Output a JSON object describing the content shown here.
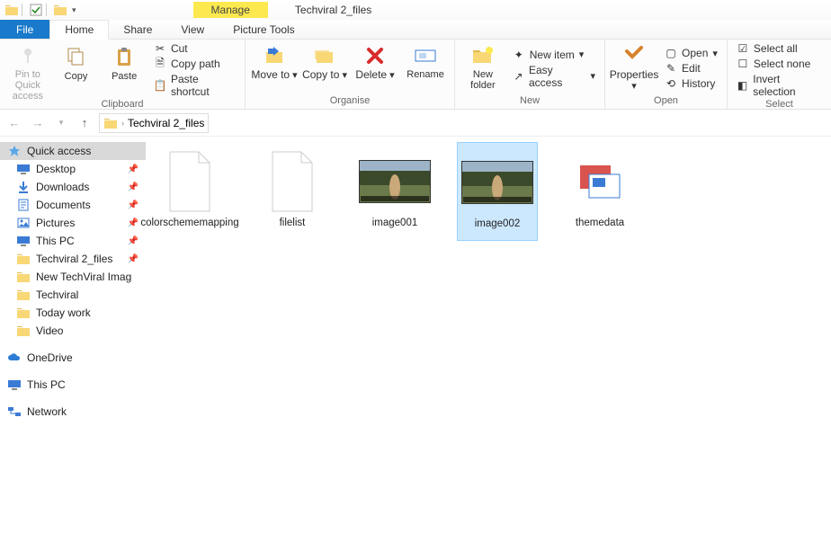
{
  "colors": {
    "accent": "#1979ca",
    "selected_bg": "#cce8ff",
    "context_tab": "#fce94f"
  },
  "titlebar": {
    "manage": "Manage",
    "title": "Techviral 2_files"
  },
  "tabs": {
    "file": "File",
    "home": "Home",
    "share": "Share",
    "view": "View",
    "context": "Picture Tools"
  },
  "ribbon": {
    "clipboard": {
      "label": "Clipboard",
      "pin": "Pin to Quick access",
      "copy": "Copy",
      "paste": "Paste",
      "cut": "Cut",
      "copy_path": "Copy path",
      "paste_shortcut": "Paste shortcut"
    },
    "organise": {
      "label": "Organise",
      "move_to": "Move to",
      "copy_to": "Copy to",
      "delete": "Delete",
      "rename": "Rename"
    },
    "new": {
      "label": "New",
      "new_folder": "New folder",
      "new_item": "New item",
      "easy_access": "Easy access"
    },
    "open": {
      "label": "Open",
      "properties": "Properties",
      "open": "Open",
      "edit": "Edit",
      "history": "History"
    },
    "select": {
      "label": "Select",
      "select_all": "Select all",
      "select_none": "Select none",
      "invert": "Invert selection"
    }
  },
  "breadcrumb": {
    "current": "Techviral 2_files"
  },
  "navpane": {
    "quick_access": "Quick access",
    "items": [
      {
        "label": "Desktop",
        "icon": "desktop",
        "pinned": true
      },
      {
        "label": "Downloads",
        "icon": "downloads",
        "pinned": true
      },
      {
        "label": "Documents",
        "icon": "documents",
        "pinned": true
      },
      {
        "label": "Pictures",
        "icon": "pictures",
        "pinned": true
      },
      {
        "label": "This PC",
        "icon": "pc",
        "pinned": true
      },
      {
        "label": "Techviral 2_files",
        "icon": "folder",
        "pinned": true
      },
      {
        "label": "New TechViral Imag",
        "icon": "folder",
        "pinned": false
      },
      {
        "label": "Techviral",
        "icon": "folder",
        "pinned": false
      },
      {
        "label": "Today work",
        "icon": "folder",
        "pinned": false
      },
      {
        "label": "Video",
        "icon": "folder",
        "pinned": false
      }
    ],
    "onedrive": "OneDrive",
    "thispc": "This PC",
    "network": "Network"
  },
  "files": [
    {
      "name": "colorschememapping",
      "kind": "generic",
      "selected": false
    },
    {
      "name": "filelist",
      "kind": "generic",
      "selected": false
    },
    {
      "name": "image001",
      "kind": "image",
      "selected": false
    },
    {
      "name": "image002",
      "kind": "image",
      "selected": true
    },
    {
      "name": "themedata",
      "kind": "theme",
      "selected": false
    }
  ]
}
